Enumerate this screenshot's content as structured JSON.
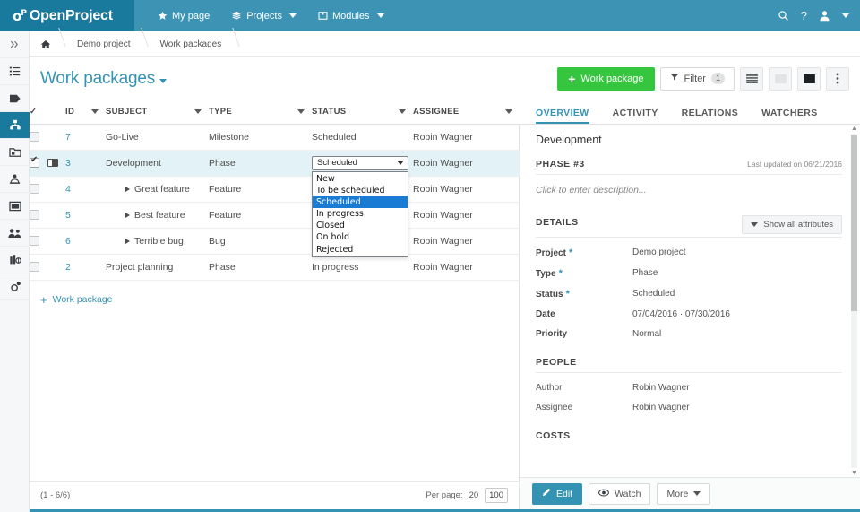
{
  "app": {
    "logo_mark": "oP",
    "logo_text": "OpenProject",
    "brand_color": "#3c93b3",
    "logo_bg": "#1a7a9e",
    "accent_green": "#35c53f"
  },
  "topnav": {
    "items": [
      {
        "label": "My page",
        "icon": "star-icon",
        "caret": false
      },
      {
        "label": "Projects",
        "icon": "projects-stack-icon",
        "caret": true
      },
      {
        "label": "Modules",
        "icon": "modules-cube-icon",
        "caret": true
      }
    ],
    "right_icons": [
      "search-icon",
      "help-icon",
      "user-avatar-icon",
      "user-caret-icon"
    ]
  },
  "rail": {
    "items": [
      {
        "name": "expand-sidebar",
        "icon": "chevrons-right-icon",
        "active": false
      },
      {
        "name": "activity",
        "icon": "list-icon",
        "active": false
      },
      {
        "name": "news",
        "icon": "tag-icon",
        "active": false
      },
      {
        "name": "work-packages",
        "icon": "work-packages-icon",
        "active": true
      },
      {
        "name": "backlogs",
        "icon": "folder-icon",
        "active": false
      },
      {
        "name": "calendar",
        "icon": "calendar-icon",
        "active": false
      },
      {
        "name": "news-board",
        "icon": "news-icon",
        "active": false
      },
      {
        "name": "members",
        "icon": "members-icon",
        "active": false
      },
      {
        "name": "cost-reports",
        "icon": "cost-reports-icon",
        "active": false
      },
      {
        "name": "settings",
        "icon": "gear-icon",
        "active": false
      }
    ]
  },
  "breadcrumb": {
    "home_icon": "home-icon",
    "items": [
      "Demo project",
      "Work packages"
    ]
  },
  "header": {
    "title": "Work packages",
    "title_caret": "caret-down-icon"
  },
  "toolbar": {
    "create_label": "Work package",
    "create_icon": "plus-icon",
    "filter_label": "Filter",
    "filter_icon": "funnel-icon",
    "filter_count": "1",
    "view_buttons": [
      {
        "name": "view-list-button",
        "icon": "list-view-icon",
        "active": false
      },
      {
        "name": "view-cards-button",
        "icon": "cards-view-icon",
        "active": false
      },
      {
        "name": "view-split-button",
        "icon": "split-view-icon",
        "active": true
      }
    ],
    "more_icon": "more-vertical-icon"
  },
  "table": {
    "columns": [
      {
        "key": "check",
        "label": "",
        "icon": "check-icon",
        "sortable": false
      },
      {
        "key": "id",
        "label": "ID",
        "sortable": true
      },
      {
        "key": "subject",
        "label": "SUBJECT",
        "sortable": true
      },
      {
        "key": "type",
        "label": "TYPE",
        "sortable": true
      },
      {
        "key": "status",
        "label": "STATUS",
        "sortable": true
      },
      {
        "key": "assignee",
        "label": "ASSIGNEE",
        "sortable": true
      }
    ],
    "rows": [
      {
        "id": "7",
        "subject": "Go-Live",
        "type": "Milestone",
        "status": "Scheduled",
        "assignee": "Robin Wagner",
        "selected": false,
        "checked": false,
        "indent": false
      },
      {
        "id": "3",
        "subject": "Development",
        "type": "Phase",
        "status": "Scheduled",
        "assignee": "Robin Wagner",
        "selected": true,
        "checked": true,
        "indent": false,
        "editing_status": true
      },
      {
        "id": "4",
        "subject": "Great feature",
        "type": "Feature",
        "status": "",
        "assignee": "Robin Wagner",
        "selected": false,
        "checked": false,
        "indent": true
      },
      {
        "id": "5",
        "subject": "Best feature",
        "type": "Feature",
        "status": "",
        "assignee": "Robin Wagner",
        "selected": false,
        "checked": false,
        "indent": true
      },
      {
        "id": "6",
        "subject": "Terrible bug",
        "type": "Bug",
        "status": "",
        "assignee": "Robin Wagner",
        "selected": false,
        "checked": false,
        "indent": true
      },
      {
        "id": "2",
        "subject": "Project planning",
        "type": "Phase",
        "status": "In progress",
        "assignee": "Robin Wagner",
        "selected": false,
        "checked": false,
        "indent": false
      }
    ],
    "add_row_label": "Work package",
    "add_row_icon": "plus-icon"
  },
  "status_dropdown": {
    "selected": "Scheduled",
    "options": [
      "New",
      "To be scheduled",
      "Scheduled",
      "In progress",
      "Closed",
      "On hold",
      "Rejected"
    ],
    "caret_icon": "caret-down-icon"
  },
  "pagination": {
    "range": "(1 - 6/6)",
    "per_page_label": "Per page:",
    "options": [
      "20",
      "100"
    ],
    "active": "100"
  },
  "detail": {
    "tabs": [
      {
        "label": "OVERVIEW",
        "active": true
      },
      {
        "label": "ACTIVITY",
        "active": false
      },
      {
        "label": "RELATIONS",
        "active": false
      },
      {
        "label": "WATCHERS",
        "active": false
      }
    ],
    "subject": "Development",
    "section_title": "PHASE #3",
    "last_updated": "Last updated on 06/21/2016",
    "description_placeholder": "Click to enter description...",
    "details_title": "DETAILS",
    "show_all_label": "Show all attributes",
    "show_all_icon": "chevron-down-icon",
    "attributes": [
      {
        "label": "Project",
        "required": true,
        "value": "Demo project"
      },
      {
        "label": "Type",
        "required": true,
        "value": "Phase"
      },
      {
        "label": "Status",
        "required": true,
        "value": "Scheduled"
      },
      {
        "label": "Date",
        "required": false,
        "value": "07/04/2016  ·  07/30/2016"
      },
      {
        "label": "Priority",
        "required": false,
        "value": "Normal"
      }
    ],
    "people_title": "PEOPLE",
    "people": [
      {
        "label": "Author",
        "value": "Robin Wagner"
      },
      {
        "label": "Assignee",
        "value": "Robin Wagner"
      }
    ],
    "costs_title": "COSTS",
    "footer": {
      "edit_label": "Edit",
      "edit_icon": "pencil-icon",
      "watch_label": "Watch",
      "watch_icon": "eye-icon",
      "more_label": "More",
      "more_icon": "caret-down-icon"
    }
  }
}
